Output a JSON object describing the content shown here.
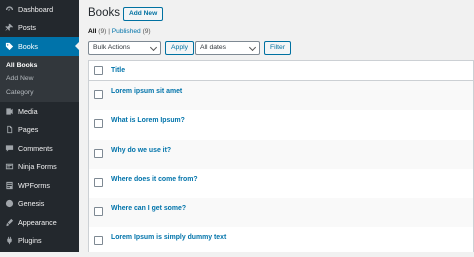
{
  "sidebar": {
    "items": [
      {
        "label": "Dashboard",
        "icon": "dashboard-icon"
      },
      {
        "label": "Posts",
        "icon": "pushpin-icon"
      },
      {
        "label": "Books",
        "icon": "tag-icon",
        "active": true
      },
      {
        "label": "Media",
        "icon": "media-icon"
      },
      {
        "label": "Pages",
        "icon": "pages-icon"
      },
      {
        "label": "Comments",
        "icon": "comments-icon"
      },
      {
        "label": "Ninja Forms",
        "icon": "ninja-forms-icon"
      },
      {
        "label": "WPForms",
        "icon": "wpforms-icon"
      },
      {
        "label": "Genesis",
        "icon": "genesis-icon"
      },
      {
        "label": "Appearance",
        "icon": "appearance-icon"
      },
      {
        "label": "Plugins",
        "icon": "plugins-icon"
      }
    ],
    "submenu": [
      {
        "label": "All Books",
        "current": true
      },
      {
        "label": "Add New"
      },
      {
        "label": "Category"
      }
    ]
  },
  "header": {
    "title": "Books",
    "add_new": "Add New"
  },
  "filters": {
    "all_label": "All",
    "all_count": "(9)",
    "separator": "|",
    "published_label": "Published",
    "published_count": "(9)"
  },
  "tablenav": {
    "bulk_actions": "Bulk Actions",
    "apply": "Apply",
    "dates": "All dates",
    "filter": "Filter"
  },
  "table": {
    "column_title": "Title",
    "rows": [
      "Lorem ipsum sit amet",
      "What is Lorem Ipsum?",
      "Why do we use it?",
      "Where does it come from?",
      "Where can I get some?",
      "Lorem Ipsum is simply dummy text"
    ]
  },
  "colors": {
    "sidebar_bg": "#23282d",
    "accent": "#0073aa",
    "page_bg": "#f1f1f1"
  }
}
